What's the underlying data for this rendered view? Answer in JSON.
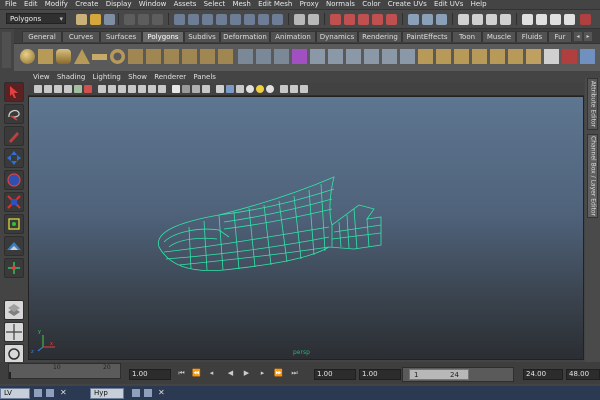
{
  "menubar": {
    "items": [
      "File",
      "Edit",
      "Modify",
      "Create",
      "Display",
      "Window",
      "Assets",
      "Select",
      "Mesh",
      "Edit Mesh",
      "Proxy",
      "Normals",
      "Color",
      "Create UVs",
      "Edit UVs",
      "Help"
    ]
  },
  "status_line": {
    "mode_value": "Polygons"
  },
  "shelf": {
    "tabs": [
      "General",
      "Curves",
      "Surfaces",
      "Polygons",
      "Subdivs",
      "Deformation",
      "Animation",
      "Dynamics",
      "Rendering",
      "PaintEffects",
      "Toon",
      "Muscle",
      "Fluids",
      "Fur"
    ],
    "active_tab": "Polygons"
  },
  "panel": {
    "menus": [
      "View",
      "Shading",
      "Lighting",
      "Show",
      "Renderer",
      "Panels"
    ]
  },
  "viewport": {
    "camera_label": "persp",
    "axis_labels": {
      "x": "x",
      "y": "y",
      "z": "z"
    }
  },
  "right_tabs": {
    "attribute_editor": "Attribute Editor",
    "channel_box": "Channel Box / Layer Editor"
  },
  "timeline": {
    "tick_labels": [
      "10",
      "20"
    ],
    "current_frame": "1.00",
    "start_time": "1.00",
    "playback_start": "1.00",
    "range_start": "1",
    "range_end": "24",
    "playback_end": "24.00",
    "end_time": "48.00"
  },
  "taskbar": {
    "item1": "LV",
    "item2": "Hyp"
  },
  "colors": {
    "wireframe": "#2fe6a8",
    "viewport_top": "#5e7691",
    "viewport_bottom": "#2b2e33",
    "active_tool": "#c0392b"
  }
}
